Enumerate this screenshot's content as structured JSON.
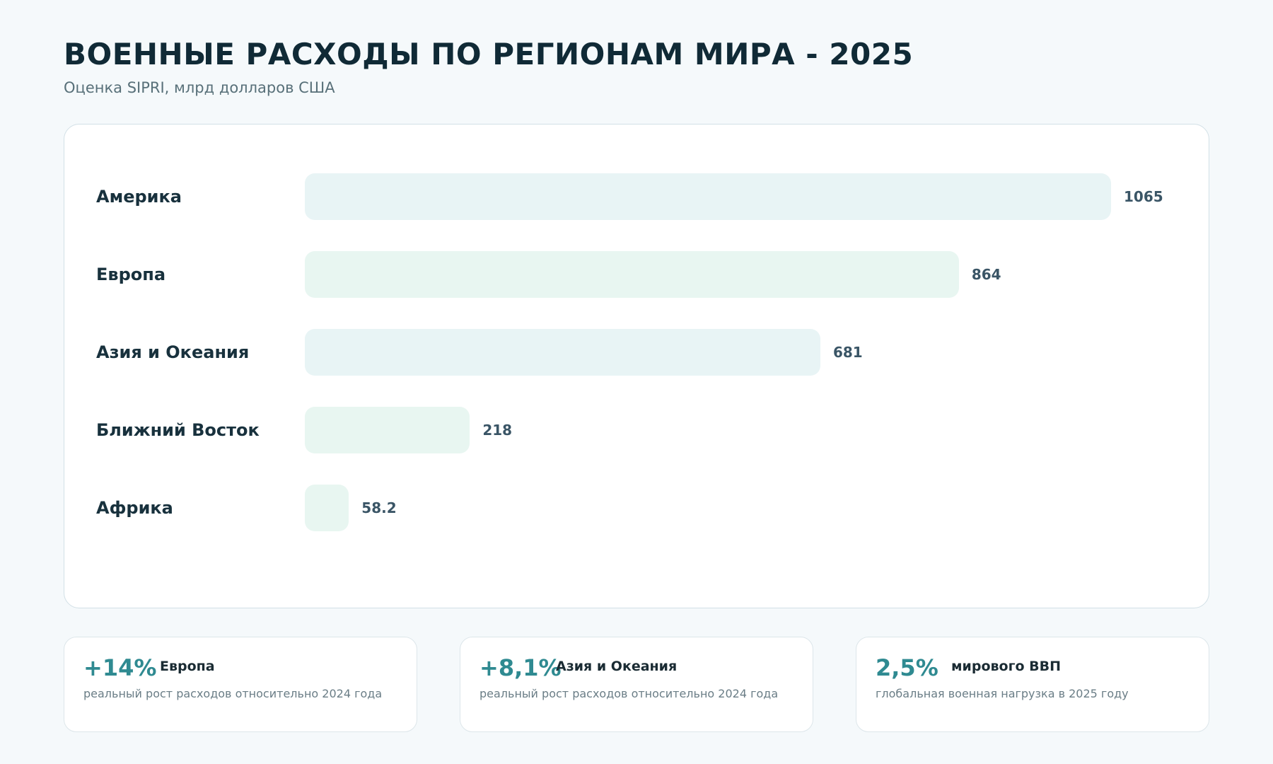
{
  "header": {
    "title": "ВОЕННЫЕ РАСХОДЫ ПО РЕГИОНАМ МИРА - 2025",
    "subtitle": "Оценка SIPRI, млрд долларов США"
  },
  "chart_data": {
    "type": "bar",
    "orientation": "horizontal",
    "title": "ВОЕННЫЕ РАСХОДЫ ПО РЕГИОНАМ МИРА - 2025",
    "subtitle": "Оценка SIPRI, млрд долларов США",
    "categories": [
      "Америка",
      "Европа",
      "Азия и Океания",
      "Ближний Восток",
      "Африка"
    ],
    "values": [
      1065,
      864,
      681,
      218,
      58.2
    ],
    "value_labels": [
      "1065",
      "864",
      "681",
      "218",
      "58.2"
    ],
    "bar_colors": [
      "#e8f4f5",
      "#e8f6f1",
      "#e8f4f5",
      "#e8f6f1",
      "#e8f6f1"
    ],
    "xlim": [
      0,
      1065
    ],
    "grid": false,
    "legend": "none"
  },
  "stats": [
    {
      "value": "+14%",
      "label": "Европа",
      "note": "реальный рост расходов относительно 2024 года"
    },
    {
      "value": "+8,1%",
      "label": "Азия и Океания",
      "note": "реальный рост расходов относительно 2024 года"
    },
    {
      "value": "2,5%",
      "label": "мирового ВВП",
      "note": "глобальная военная нагрузка в 2025 году"
    }
  ],
  "colors": {
    "background": "#f5f9fb",
    "title": "#102a36",
    "accent": "#2f8a91",
    "bar_teal": "#e8f4f5",
    "bar_mint": "#e8f6f1"
  }
}
